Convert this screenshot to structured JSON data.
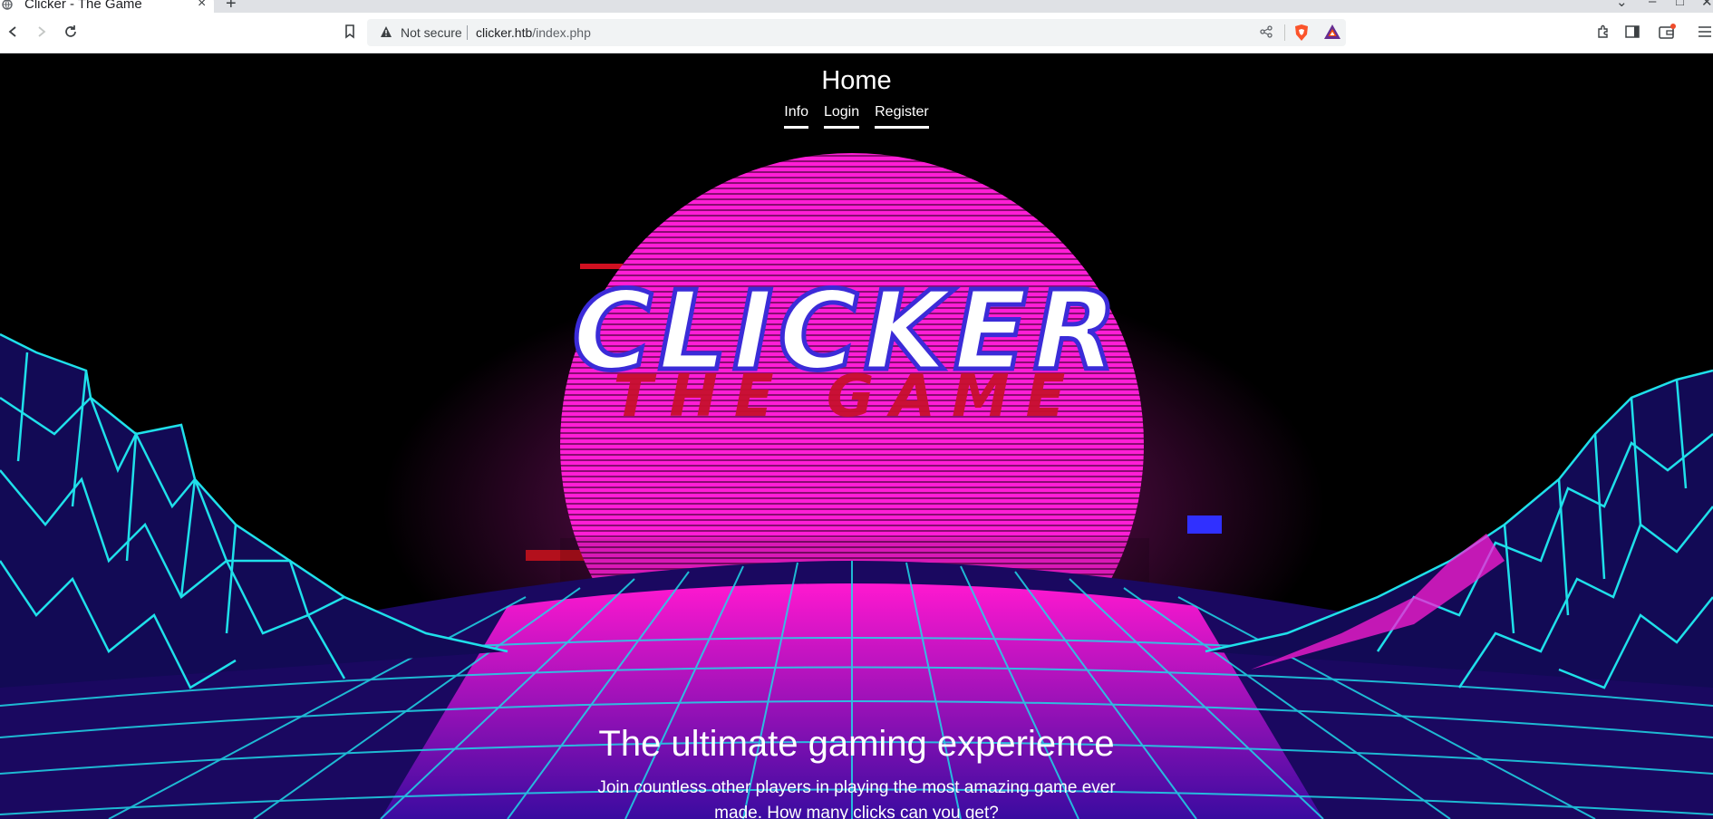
{
  "browser": {
    "tab_title": "Clicker - The Game",
    "tab_close": "×",
    "new_tab": "+",
    "security_label": "Not secure",
    "url_host": "clicker.htb",
    "url_path": "/index.php",
    "window_controls": {
      "chevron": "⌄",
      "minimize": "–",
      "maximize": "□",
      "close": "✕"
    }
  },
  "site": {
    "title": "Home",
    "nav": [
      {
        "label": "Info"
      },
      {
        "label": "Login"
      },
      {
        "label": "Register"
      }
    ],
    "logo_text": "CLICKER",
    "logo_subtext": "THE GAME",
    "headline": "The ultimate gaming experience",
    "lead": "Join countless other players in playing the most amazing game ever made. How many clicks can you get?"
  },
  "colors": {
    "sun": "#ff1ed6",
    "grid": "#1fd8e8",
    "logo_red": "#c8102e"
  }
}
